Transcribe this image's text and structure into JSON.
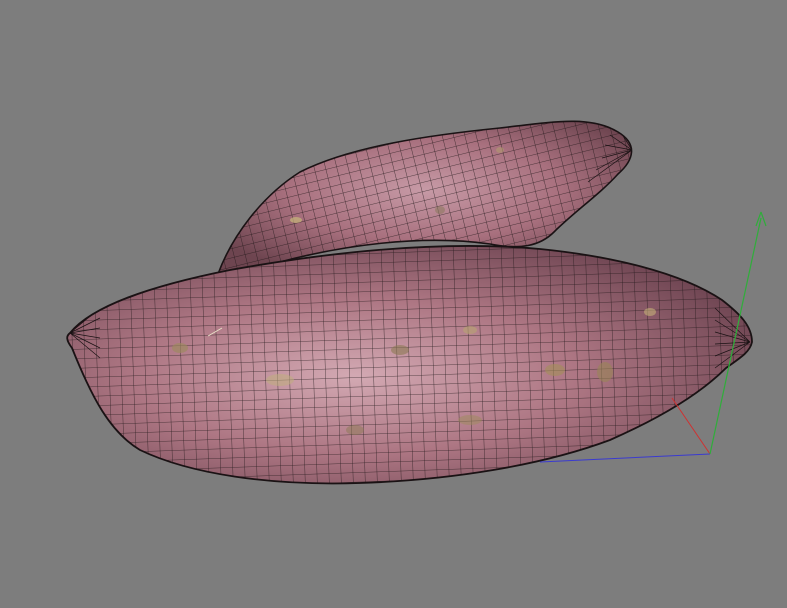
{
  "viewport": {
    "background_color": "#7d7d7d",
    "render_mode": "wireframe-on-shaded",
    "model": {
      "name": "sweet-potato-pair",
      "object_count": 2,
      "skin_color": "#a8707e",
      "wire_color": "#1a1214"
    },
    "axis_gizmo": {
      "x_color": "#d03030",
      "y_color": "#2fae3a",
      "z_color": "#3a3ad0"
    }
  }
}
